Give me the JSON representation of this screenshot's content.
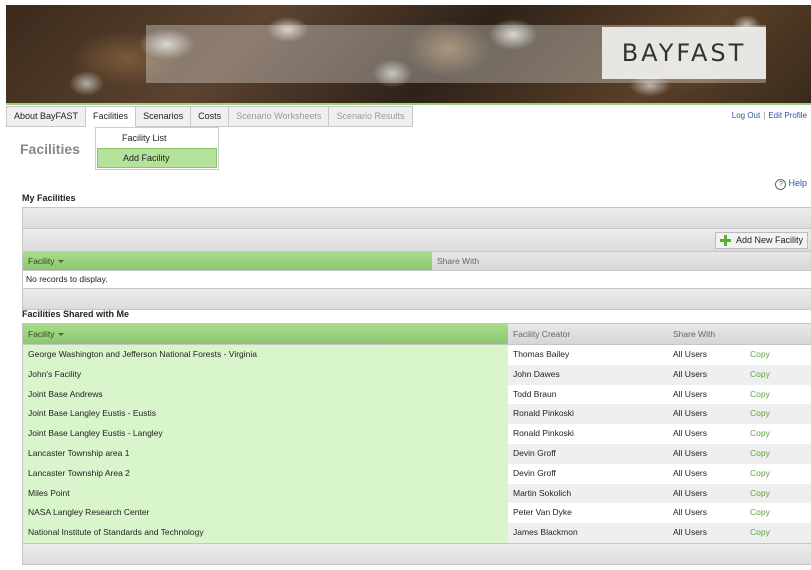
{
  "header": {
    "logo": "BAYFAST"
  },
  "nav": {
    "items": [
      {
        "label": "About BayFAST"
      },
      {
        "label": "Facilities"
      },
      {
        "label": "Scenarios"
      },
      {
        "label": "Costs"
      },
      {
        "label": "Scenario Worksheets"
      },
      {
        "label": "Scenario Results"
      }
    ],
    "dropdown": [
      "Facility List",
      "Add Facility"
    ]
  },
  "top_links": {
    "logout": "Log Out",
    "separator": "|",
    "edit_profile": "Edit Profile"
  },
  "page_title": "Facilities",
  "help": {
    "icon": "?",
    "label": "Help"
  },
  "my_facilities": {
    "title": "My Facilities",
    "add_button": "Add New Facility",
    "columns": [
      "Facility",
      "Share With"
    ],
    "empty_message": "No records to display."
  },
  "shared": {
    "title": "Facilities Shared with Me",
    "columns": [
      "Facility",
      "Facility Creator",
      "Share With"
    ],
    "rows": [
      {
        "facility": "George Washington and Jefferson National Forests - Virginia",
        "creator": "Thomas Bailey",
        "share": "All Users",
        "action": "Copy"
      },
      {
        "facility": "John's Facility",
        "creator": "John Dawes",
        "share": "All Users",
        "action": "Copy"
      },
      {
        "facility": "Joint Base Andrews",
        "creator": "Todd Braun",
        "share": "All Users",
        "action": "Copy"
      },
      {
        "facility": "Joint Base Langley Eustis - Eustis",
        "creator": "Ronald Pinkoski",
        "share": "All Users",
        "action": "Copy"
      },
      {
        "facility": "Joint Base Langley Eustis - Langley",
        "creator": "Ronald Pinkoski",
        "share": "All Users",
        "action": "Copy"
      },
      {
        "facility": "Lancaster Township area 1",
        "creator": "Devin Groff",
        "share": "All Users",
        "action": "Copy"
      },
      {
        "facility": "Lancaster Township Area 2",
        "creator": "Devin Groff",
        "share": "All Users",
        "action": "Copy"
      },
      {
        "facility": "Miles Point",
        "creator": "Martin Sokolich",
        "share": "All Users",
        "action": "Copy"
      },
      {
        "facility": "NASA Langley Research Center",
        "creator": "Peter Van Dyke",
        "share": "All Users",
        "action": "Copy"
      },
      {
        "facility": "National Institute of Standards and Technology",
        "creator": "James Blackmon",
        "share": "All Users",
        "action": "Copy"
      }
    ]
  }
}
